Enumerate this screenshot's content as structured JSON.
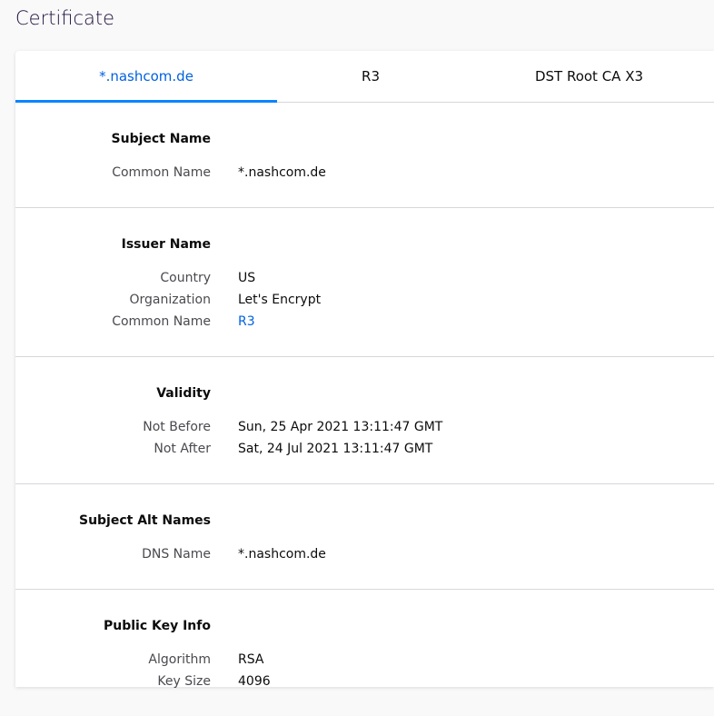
{
  "page": {
    "title": "Certificate"
  },
  "tabs": [
    {
      "label": "*.nashcom.de"
    },
    {
      "label": "R3"
    },
    {
      "label": "DST Root CA X3"
    }
  ],
  "sections": [
    {
      "heading": "Subject Name",
      "rows": [
        {
          "label": "Common Name",
          "value": "*.nashcom.de"
        }
      ]
    },
    {
      "heading": "Issuer Name",
      "rows": [
        {
          "label": "Country",
          "value": "US"
        },
        {
          "label": "Organization",
          "value": "Let's Encrypt"
        },
        {
          "label": "Common Name",
          "value": "R3"
        }
      ]
    },
    {
      "heading": "Validity",
      "rows": [
        {
          "label": "Not Before",
          "value": "Sun, 25 Apr 2021 13:11:47 GMT"
        },
        {
          "label": "Not After",
          "value": "Sat, 24 Jul 2021 13:11:47 GMT"
        }
      ]
    },
    {
      "heading": "Subject Alt Names",
      "rows": [
        {
          "label": "DNS Name",
          "value": "*.nashcom.de"
        }
      ]
    },
    {
      "heading": "Public Key Info",
      "rows": [
        {
          "label": "Algorithm",
          "value": "RSA"
        },
        {
          "label": "Key Size",
          "value": "4096"
        }
      ]
    }
  ],
  "colors": {
    "accent": "#0a84ff",
    "link": "#0060df",
    "divider": "#d7d7db"
  }
}
